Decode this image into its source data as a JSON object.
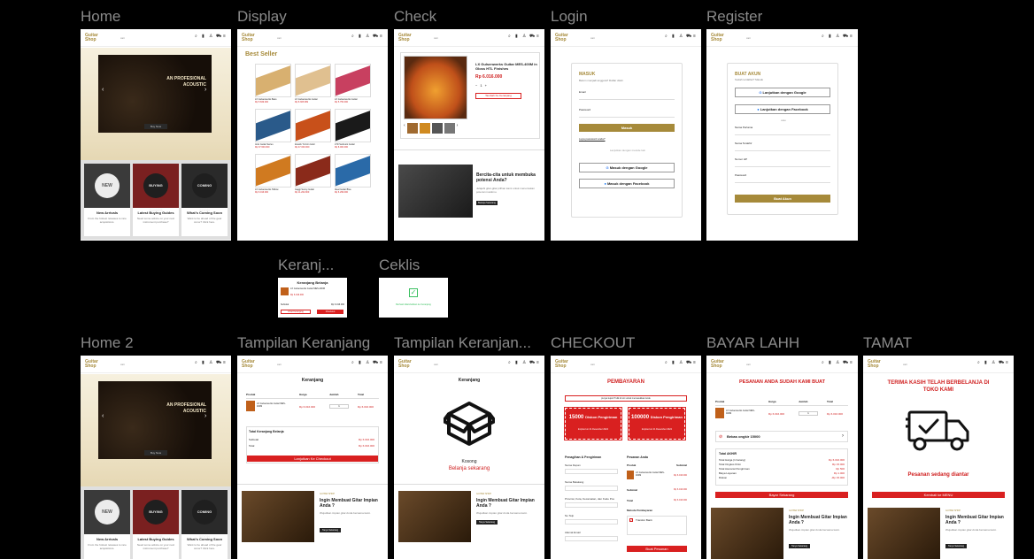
{
  "frames": {
    "home": "Home",
    "display": "Display",
    "check": "Check",
    "login": "Login",
    "register": "Register",
    "keranjang_small": "Keranj...",
    "ceklis": "Ceklis",
    "home2": "Home 2",
    "tampilan_keranjang": "Tampilan Keranjang",
    "tampilan_keranjang2": "Tampilan Keranjan...",
    "checkout": "CHECKOUT",
    "bayar": "BAYAR LAHH",
    "tamat": "TAMAT"
  },
  "header": {
    "logo_line1": "Guitar",
    "logo_line2": "Shop",
    "search": "cari"
  },
  "hero": {
    "title": "AN PROFESIONAL\nACOUSTIC",
    "button": "Buy Now"
  },
  "cards": [
    {
      "badge": "NEW",
      "title": "New Arrivals",
      "text": "From the hottest releases to rare acquisitions."
    },
    {
      "badge": "BUYING GUIDES",
      "title": "Latest Buying Guides",
      "text": "Need some advice on your next instrument purchase?"
    },
    {
      "badge": "COMING SOON",
      "title": "What's Coming Soon",
      "text": "Want to be ahead of the gear curve? Click here."
    }
  ],
  "display": {
    "title": "Best Seller",
    "products": [
      {
        "name": "LX Gulsenwerks Bass",
        "price": "Rp 5.849.000"
      },
      {
        "name": "LX Gulsenwerks Guitar",
        "price": "Rp 8.305.999"
      },
      {
        "name": "LX Gulsenwerks Guitar",
        "price": "Rp 5.750.000"
      },
      {
        "name": "Ionic Guitar Series",
        "price": "Rp 37.600.000"
      },
      {
        "name": "Zewick Tu'mim Gold",
        "price": "Rp 47.000.000"
      },
      {
        "name": "LTD Sunburst Guitar",
        "price": "Rp 8.000.000"
      },
      {
        "name": "LX Gulsenwerks Hollow",
        "price": "Rp 6.016.000"
      },
      {
        "name": "Gaggi Sunny Guitar",
        "price": "Rp 11.262.000"
      },
      {
        "name": "Ideal Guitar Blue",
        "price": "Rp 6.299.000"
      }
    ]
  },
  "check": {
    "product": "LX Gulsenwerks Guitar MES-400M in Gloss HTL Finishes",
    "price": "Rp 6.016.000",
    "qty": "1",
    "add_button": "Tambah Ke Keranjang",
    "promo_title": "Bercita-cita untuk membuka potensi Anda?",
    "promo_text": "Jelajahi gitar-gitar pilihan kami untuk menemukan potensi musikmu.",
    "promo_button": "Belanja Sekarang"
  },
  "login": {
    "title": "MASUK",
    "subtitle": "Belum menjadi anggota? Daftar disini",
    "email_label": "Email",
    "password_label": "Password",
    "submit": "Masuk",
    "forgot": "Lupa password anda?",
    "or": "Lanjutkan dengan metode lain",
    "google": "Masuk dengan Google",
    "facebook": "Masuk dengan Facebook"
  },
  "register": {
    "title": "BUAT AKUN",
    "subtitle": "Sudah terdaftar? Masuk",
    "google": "Lanjutkan dengan Google",
    "facebook": "Lanjutkan dengan Facebook",
    "or": "atau",
    "fields": [
      "Nama Pertama",
      "Nama Terakhir",
      "Nomor HP",
      "Password"
    ],
    "submit": "Buat Akun"
  },
  "mini_cart": {
    "title": "Keranjang Belanja",
    "item": "LX Gulsenwerks Guitar MES-400M",
    "price": "Rp 6.016.000",
    "subtotal_label": "Subtotal",
    "subtotal": "Rp 6.016.000",
    "view": "Lihat Keranjang",
    "checkout": "Checkout"
  },
  "ceklis": {
    "text": "Berhasil ditambahkan ke Keranjang"
  },
  "cart": {
    "title": "Keranjang",
    "col_product": "Produk",
    "col_price": "Harga",
    "col_qty": "Jumlah",
    "col_total": "Total",
    "item": "LX Gulsenwerks Guitar MES-400M",
    "price": "Rp 6.016.000",
    "qty": "1",
    "total": "Rp 6.016.000",
    "summary_title": "Total Keranjang Belanja",
    "subtotal_label": "Subtotal",
    "subtotal": "Rp 6.016.000",
    "total_label": "Total",
    "grand": "Rp 6.016.000",
    "checkout": "Lanjutkan Ke Checkout",
    "empty": "Kosong",
    "shop_now": "Belanja sekarang",
    "promo_small": "GUITAR SHOP",
    "promo_title": "Ingin Membuat Gitar Impian Anda ?",
    "promo_text": "Wujudkan impian gitar Anda bersama kami.",
    "promo_button": "Tanya Sekarang"
  },
  "checkout": {
    "title": "PEMBAYARAN",
    "notice": "punya kupon? klik di sini untuk memasukkan kode",
    "voucher1_amount": "15000",
    "voucher1_label": "Diskon Pengiriman",
    "voucher1_exp": "Expired on 21 Desember 2024",
    "voucher2_amount": "100000",
    "voucher2_label": "Diskon Pengiriman",
    "voucher2_exp": "Expired on 21 Desember 2024",
    "billing_title": "Penagihan & Pengiriman",
    "fields": [
      "Nama Depan",
      "Nama Belakang",
      "Provinsi, Kota, Kecamatan, dan Kode Pos",
      "No Telp",
      "Alamat Email"
    ],
    "order_title": "Pesanan Anda",
    "order_product": "Produk",
    "order_subtotal": "Subtotal",
    "order_item": "LX Gulsenwerks Guitar MES-400M",
    "order_price": "Rp 6.016.000",
    "subtotal_label": "Subtotal",
    "total_label": "Total",
    "amount": "Rp 6.016.000",
    "method_title": "Metode Pembayaran",
    "method": "Transfer Bank",
    "place": "Buat Pesanan"
  },
  "bayar": {
    "title": "PESANAN ANDA SUDAH KAMI BUAT",
    "free": "Bebas ongkir 15000",
    "total_title": "Total AKHIR",
    "rows": [
      {
        "label": "Total Harga (1 barang)",
        "value": "Rp 6.016.000"
      },
      {
        "label": "Total Ongkos Kirim",
        "value": "Rp 15.000"
      },
      {
        "label": "Total Asuransi Pengiriman",
        "value": "Rp 500"
      },
      {
        "label": "Biaya Layanan",
        "value": "Rp 1.000"
      },
      {
        "label": "Diskon",
        "value": "-Rp 15.000"
      }
    ],
    "pay": "Bayar Sekarang"
  },
  "tamat": {
    "title": "TERIMA KASIH TELAH BERBELANJA DI TOKO KAMI",
    "status": "Pesanan sedang diantar",
    "back": "Kembali ke MENU"
  }
}
